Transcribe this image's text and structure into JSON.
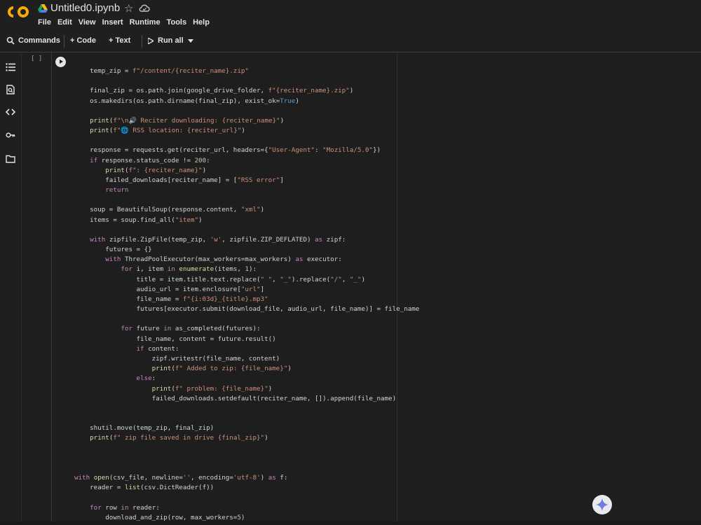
{
  "header": {
    "title": "Untitled0.ipynb",
    "menu": [
      "File",
      "Edit",
      "View",
      "Insert",
      "Runtime",
      "Tools",
      "Help"
    ]
  },
  "toolbar": {
    "commands": "Commands",
    "code": "+ Code",
    "text": "+ Text",
    "run_all": "Run all"
  },
  "cell": {
    "exec_count": "[ ]"
  },
  "code_lines": [
    "    temp_zip = f\"/content/{reciter_name}.zip\"",
    "",
    "    final_zip = os.path.join(google_drive_folder, f\"{reciter_name}.zip\")",
    "    os.makedirs(os.path.dirname(final_zip), exist_ok=True)",
    "",
    "    print(f\"\\n🔊 Reciter downloading: {reciter_name}\")",
    "    print(f\"🌐 RSS location: {reciter_url}\")",
    "",
    "    response = requests.get(reciter_url, headers={\"User-Agent\": \"Mozilla/5.0\"})",
    "    if response.status_code != 200:",
    "        print(f\": {reciter_name}\")",
    "        failed_downloads[reciter_name] = [\"RSS error\"]",
    "        return",
    "",
    "    soup = BeautifulSoup(response.content, \"xml\")",
    "    items = soup.find_all(\"item\")",
    "",
    "    with zipfile.ZipFile(temp_zip, 'w', zipfile.ZIP_DEFLATED) as zipf:",
    "        futures = {}",
    "        with ThreadPoolExecutor(max_workers=max_workers) as executor:",
    "            for i, item in enumerate(items, 1):",
    "                title = item.title.text.replace(\" \", \"_\").replace(\"/\", \"_\")",
    "                audio_url = item.enclosure[\"url\"]",
    "                file_name = f\"{i:03d}_{title}.mp3\"",
    "                futures[executor.submit(download_file, audio_url, file_name)] = file_name",
    "",
    "            for future in as_completed(futures):",
    "                file_name, content = future.result()",
    "                if content:",
    "                    zipf.writestr(file_name, content)",
    "                    print(f\" Added to zip: {file_name}\")",
    "                else:",
    "                    print(f\" problem: {file_name}\")",
    "                    failed_downloads.setdefault(reciter_name, []).append(file_name)",
    "",
    "",
    "    shutil.move(temp_zip, final_zip)",
    "    print(f\" zip file saved in drive {final_zip}\")",
    "",
    "",
    "",
    "with open(csv_file, newline='', encoding='utf-8') as f:",
    "    reader = list(csv.DictReader(f))",
    "",
    "    for row in reader:",
    "        download_and_zip(row, max_workers=5)"
  ]
}
